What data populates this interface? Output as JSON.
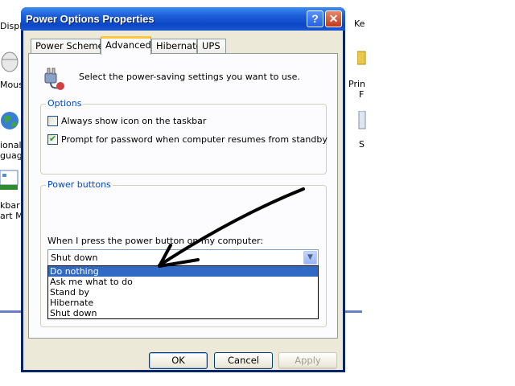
{
  "background": {
    "items_left": [
      "Display",
      "Mouse",
      "ional",
      "guage",
      "kbar",
      "art Me"
    ],
    "items_right": [
      "Ke",
      "Prin",
      "F",
      "S"
    ]
  },
  "window": {
    "title": "Power Options Properties",
    "help_label": "?",
    "close_label": "✕",
    "tabs": [
      "Power Schemes",
      "Advanced",
      "Hibernate",
      "UPS"
    ],
    "active_tab": "Advanced",
    "intro_text": "Select the power-saving settings you want to use.",
    "options": {
      "label": "Options",
      "always_show_icon": {
        "label": "Always show icon on the taskbar",
        "checked": false
      },
      "prompt_password": {
        "label": "Prompt for password when computer resumes from standby",
        "checked": true
      }
    },
    "power_buttons": {
      "label": "Power buttons",
      "power_button_label": "When I press the power button on my computer:",
      "selected_value": "Shut down",
      "options": [
        "Do nothing",
        "Ask me what to do",
        "Stand by",
        "Hibernate",
        "Shut down"
      ],
      "highlighted_option": "Do nothing"
    },
    "buttons": {
      "ok": "OK",
      "cancel": "Cancel",
      "apply": "Apply"
    }
  },
  "colors": {
    "titlebar": "#0b48c7",
    "group_label": "#0046d5",
    "selection": "#316ac5",
    "dialog_face": "#ece9d8"
  }
}
